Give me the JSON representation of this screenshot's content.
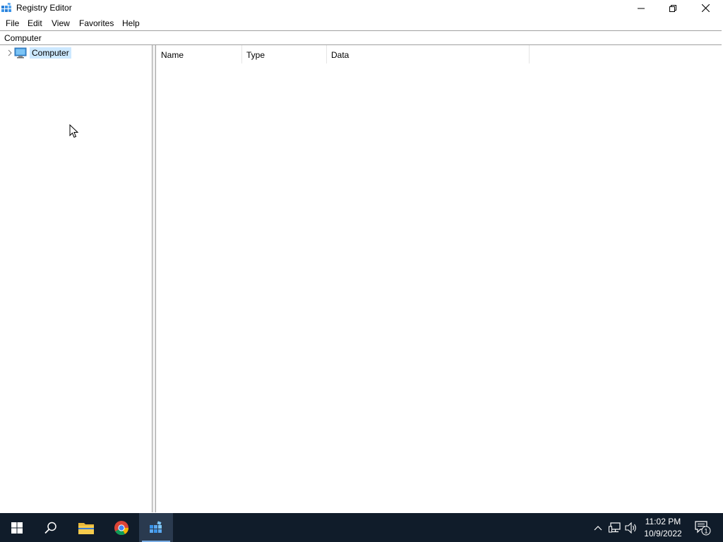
{
  "window": {
    "title": "Registry Editor",
    "controls": [
      "minimize",
      "restore",
      "close"
    ]
  },
  "menu": {
    "file": "File",
    "edit": "Edit",
    "view": "View",
    "favorites": "Favorites",
    "help": "Help"
  },
  "address": {
    "path": "Computer"
  },
  "tree": {
    "root_label": "Computer",
    "root_icon": "computer-icon",
    "expanded": false
  },
  "list": {
    "columns": {
      "name": "Name",
      "type": "Type",
      "data": "Data"
    },
    "rows": []
  },
  "taskbar": {
    "apps": [
      "start-icon",
      "search-icon",
      "file-explorer-icon",
      "chrome-icon",
      "registry-editor-icon"
    ],
    "active_app": "registry-editor-icon",
    "time": "11:02 PM",
    "date": "10/9/2022",
    "notification_count": "1"
  },
  "colors": {
    "selection": "#cce8ff",
    "taskbar": "#101c2a",
    "accent": "#7aaee6"
  }
}
